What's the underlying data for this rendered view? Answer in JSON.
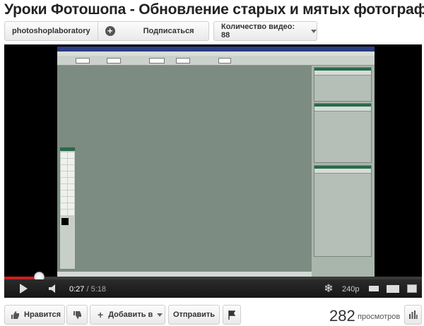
{
  "video": {
    "title": "Уроки Фотошопа - Обновление старых и мятых фотографий"
  },
  "channel": {
    "name": "photoshoplaboratory",
    "subscribe_label": "Подписаться",
    "video_count_label": "Количество видео: 88"
  },
  "player": {
    "current_time": "0:27",
    "duration": "/ 5:18",
    "quality": "240p",
    "progress_fraction": 0.085
  },
  "actions": {
    "like_label": "Нравится",
    "add_to_label": "Добавить в",
    "share_label": "Отправить"
  },
  "stats": {
    "views_count": "282",
    "views_label": "просмотров"
  },
  "icons": [
    "plus-icon",
    "chevron-down-icon",
    "play-icon",
    "volume-icon",
    "snowflake-icon",
    "small-player-icon",
    "large-player-icon",
    "fullscreen-icon",
    "thumbs-up-icon",
    "thumbs-down-icon",
    "flag-icon",
    "stats-icon"
  ],
  "colors": {
    "progress_played": "#cc1e1e",
    "player_background": "#000000"
  }
}
